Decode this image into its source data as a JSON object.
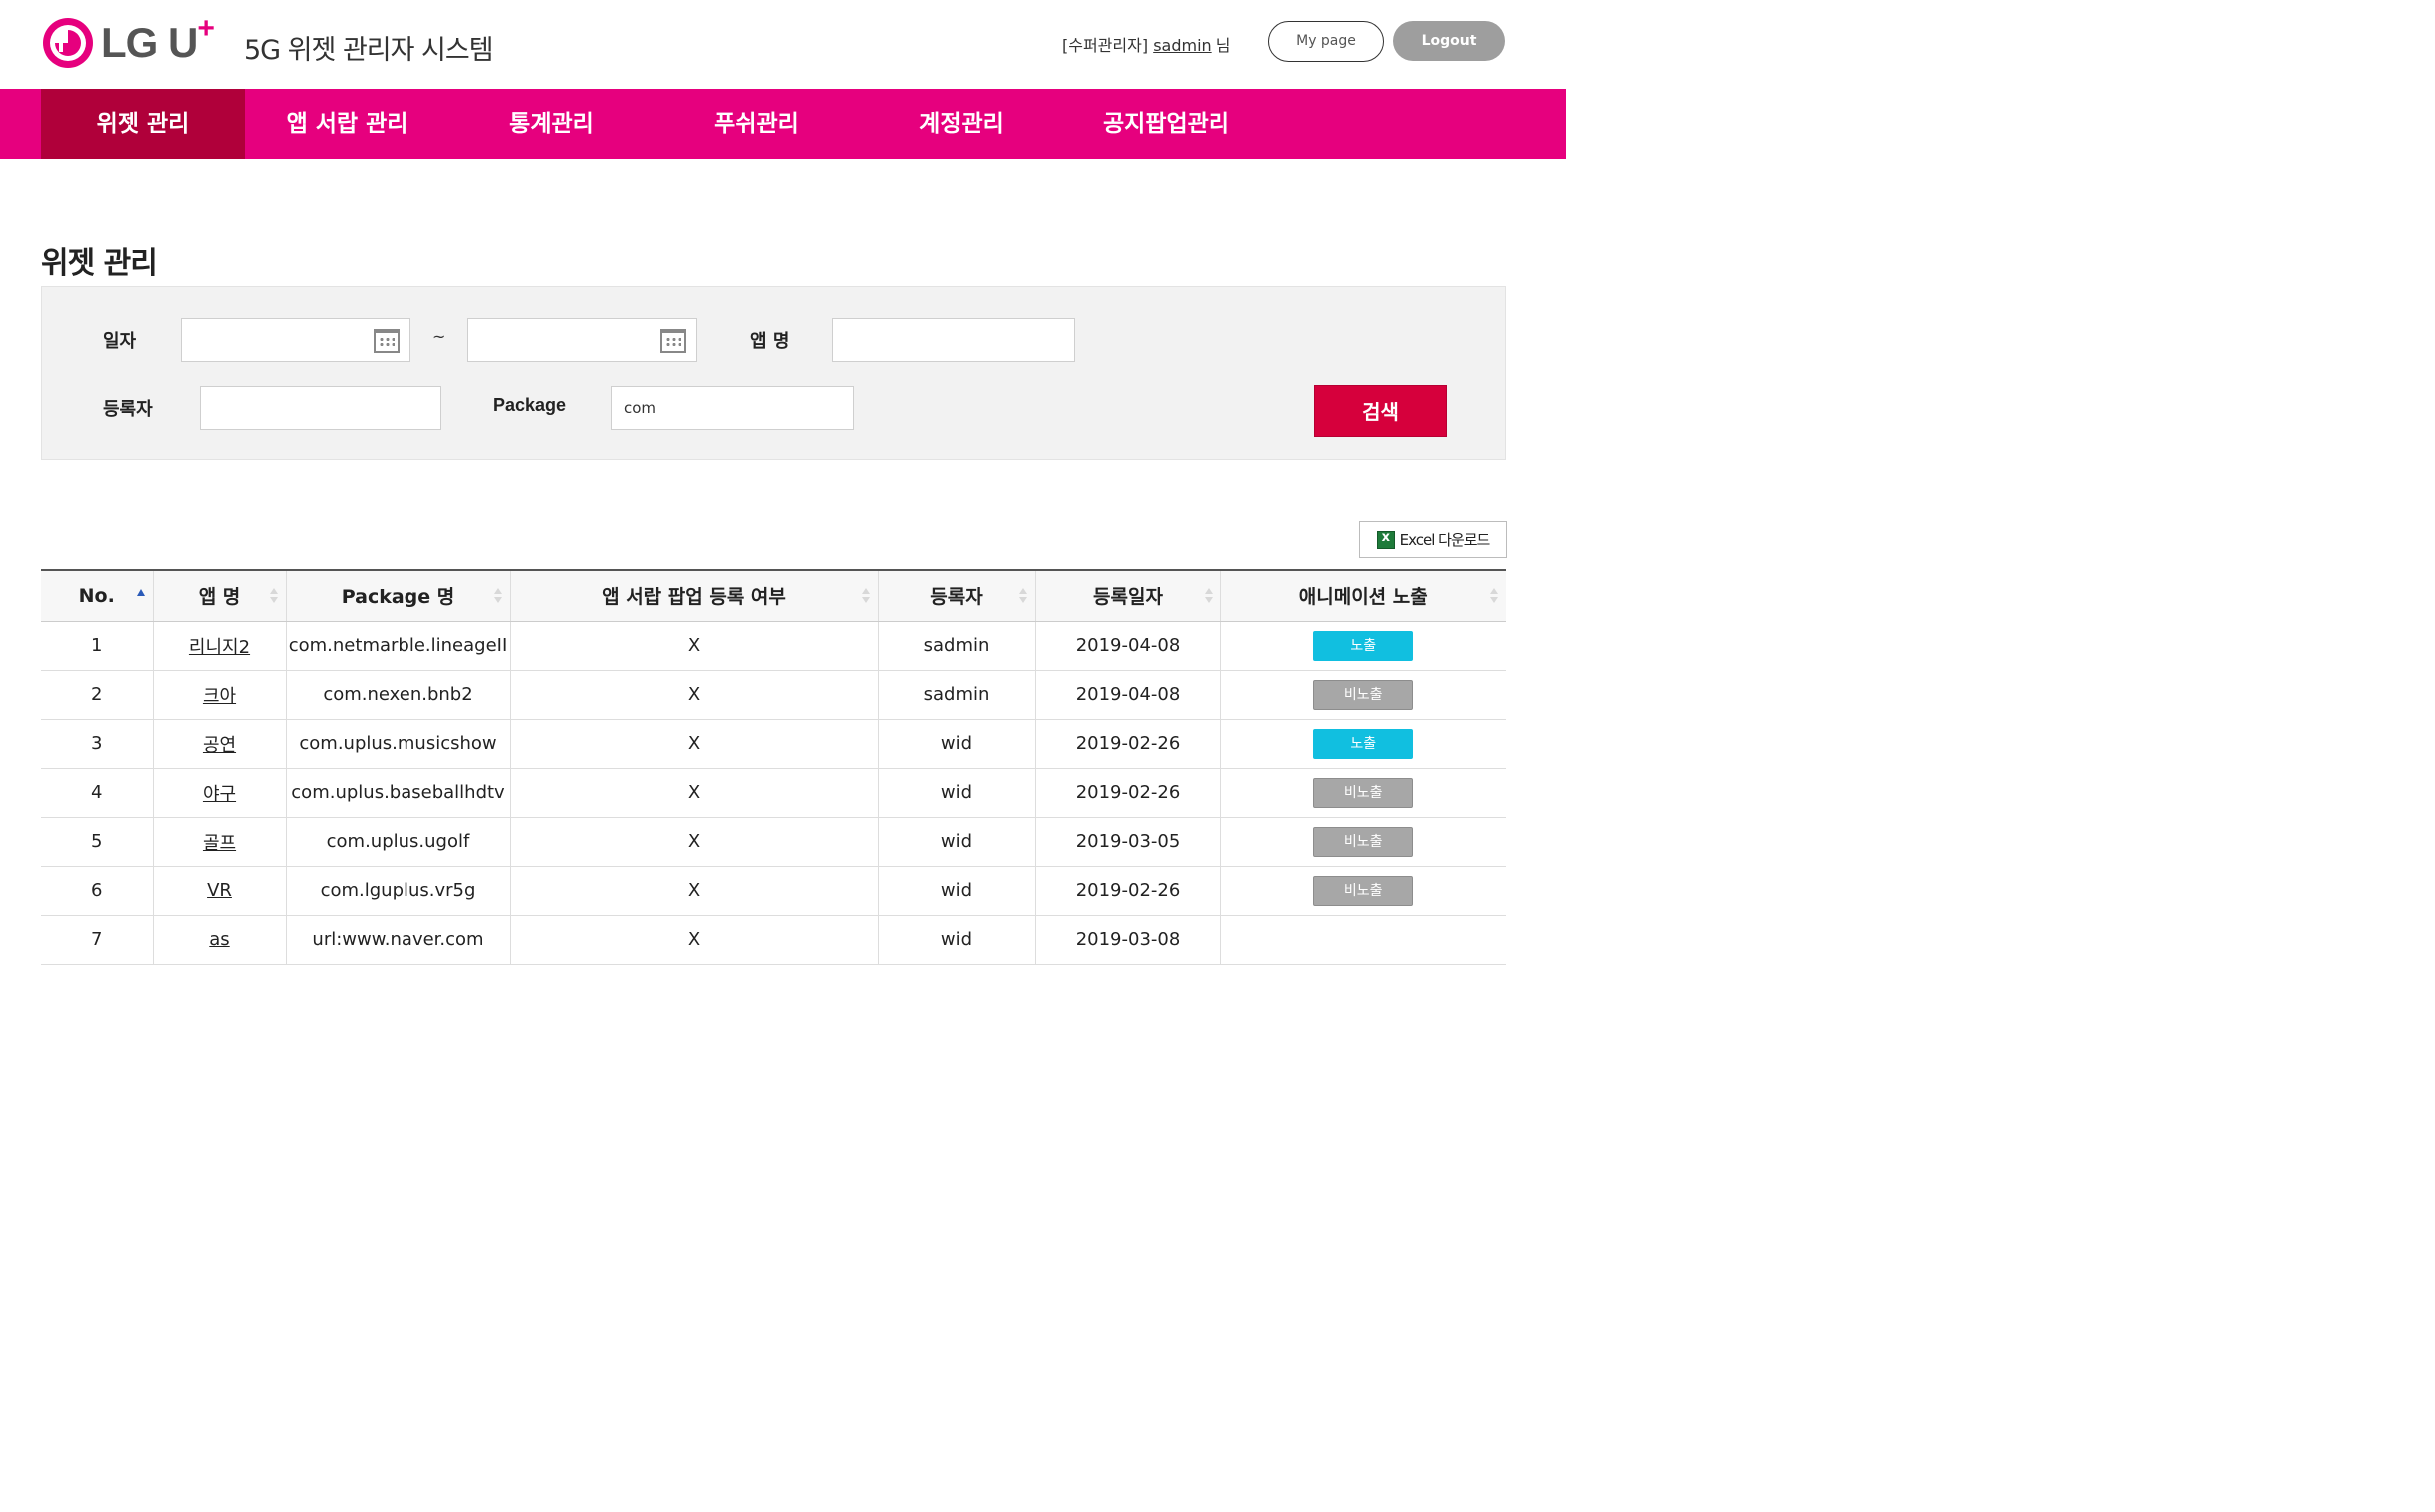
{
  "header": {
    "logo_text": "LG U",
    "logo_plus": "+",
    "system_title": "5G 위젯 관리자 시스템",
    "user_prefix": "[수퍼관리자]",
    "user_name": "sadmin",
    "user_suffix": "님",
    "mypage_label": "My page",
    "logout_label": "Logout"
  },
  "nav": {
    "items": [
      {
        "label": "위젯 관리"
      },
      {
        "label": "앱 서랍 관리"
      },
      {
        "label": "통계관리"
      },
      {
        "label": "푸쉬관리"
      },
      {
        "label": "계정관리"
      },
      {
        "label": "공지팝업관리"
      }
    ]
  },
  "page_title": "위젯 관리",
  "search": {
    "date_label": "일자",
    "date_from": "",
    "date_separator": "~",
    "date_to": "",
    "app_name_label": "앱 명",
    "app_name_value": "",
    "registrant_label": "등록자",
    "registrant_value": "",
    "package_label": "Package",
    "package_value": "com",
    "search_button": "검색"
  },
  "excel_button": "Excel 다운로드",
  "table": {
    "headers": [
      "No.",
      "앱 명",
      "Package 명",
      "앱 서랍 팝업 등록 여부",
      "등록자",
      "등록일자",
      "애니메이션 노출"
    ],
    "rows": [
      {
        "no": "1",
        "app": "리니지2",
        "package": "com.netmarble.lineageII",
        "drawer": "X",
        "registrant": "sadmin",
        "date": "2019-04-08",
        "anim": "노출"
      },
      {
        "no": "2",
        "app": "크아",
        "package": "com.nexen.bnb2",
        "drawer": "X",
        "registrant": "sadmin",
        "date": "2019-04-08",
        "anim": "비노출"
      },
      {
        "no": "3",
        "app": "공연",
        "package": "com.uplus.musicshow",
        "drawer": "X",
        "registrant": "wid",
        "date": "2019-02-26",
        "anim": "노출"
      },
      {
        "no": "4",
        "app": "야구",
        "package": "com.uplus.baseballhdtv",
        "drawer": "X",
        "registrant": "wid",
        "date": "2019-02-26",
        "anim": "비노출"
      },
      {
        "no": "5",
        "app": "골프",
        "package": "com.uplus.ugolf",
        "drawer": "X",
        "registrant": "wid",
        "date": "2019-03-05",
        "anim": "비노출"
      },
      {
        "no": "6",
        "app": "VR",
        "package": "com.lguplus.vr5g",
        "drawer": "X",
        "registrant": "wid",
        "date": "2019-02-26",
        "anim": "비노출"
      },
      {
        "no": "7",
        "app": "as",
        "package": "url:www.naver.com",
        "drawer": "X",
        "registrant": "wid",
        "date": "2019-03-08",
        "anim": ""
      }
    ]
  },
  "colors": {
    "brand_pink": "#e6007e",
    "nav_active": "#b0003a",
    "search_button": "#d6003c",
    "badge_show": "#11bfe0",
    "badge_hide": "#a7a7a7"
  }
}
